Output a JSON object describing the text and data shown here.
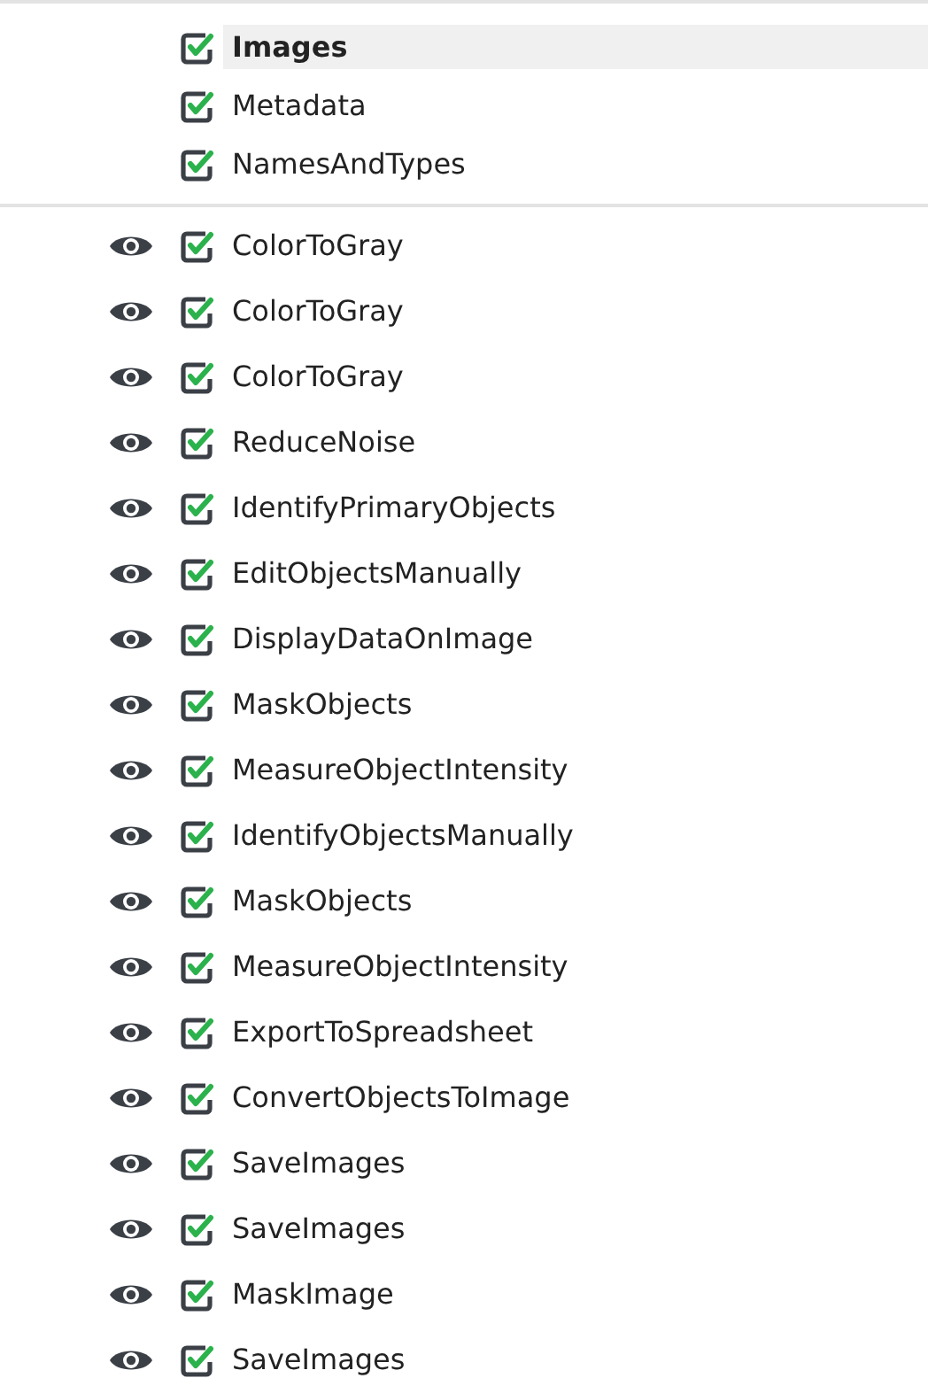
{
  "input_modules": [
    {
      "name": "Images",
      "selected": true,
      "enabled": true
    },
    {
      "name": "Metadata",
      "selected": false,
      "enabled": true
    },
    {
      "name": "NamesAndTypes",
      "selected": false,
      "enabled": true
    }
  ],
  "modules": [
    {
      "name": "ColorToGray",
      "visible": true,
      "enabled": true
    },
    {
      "name": "ColorToGray",
      "visible": true,
      "enabled": true
    },
    {
      "name": "ColorToGray",
      "visible": true,
      "enabled": true
    },
    {
      "name": "ReduceNoise",
      "visible": true,
      "enabled": true
    },
    {
      "name": "IdentifyPrimaryObjects",
      "visible": true,
      "enabled": true
    },
    {
      "name": "EditObjectsManually",
      "visible": true,
      "enabled": true
    },
    {
      "name": "DisplayDataOnImage",
      "visible": true,
      "enabled": true
    },
    {
      "name": "MaskObjects",
      "visible": true,
      "enabled": true
    },
    {
      "name": "MeasureObjectIntensity",
      "visible": true,
      "enabled": true
    },
    {
      "name": "IdentifyObjectsManually",
      "visible": true,
      "enabled": true
    },
    {
      "name": "MaskObjects",
      "visible": true,
      "enabled": true
    },
    {
      "name": "MeasureObjectIntensity",
      "visible": true,
      "enabled": true
    },
    {
      "name": "ExportToSpreadsheet",
      "visible": true,
      "enabled": true
    },
    {
      "name": "ConvertObjectsToImage",
      "visible": true,
      "enabled": true
    },
    {
      "name": "SaveImages",
      "visible": true,
      "enabled": true
    },
    {
      "name": "SaveImages",
      "visible": true,
      "enabled": true
    },
    {
      "name": "MaskImage",
      "visible": true,
      "enabled": true
    },
    {
      "name": "SaveImages",
      "visible": true,
      "enabled": true
    }
  ]
}
